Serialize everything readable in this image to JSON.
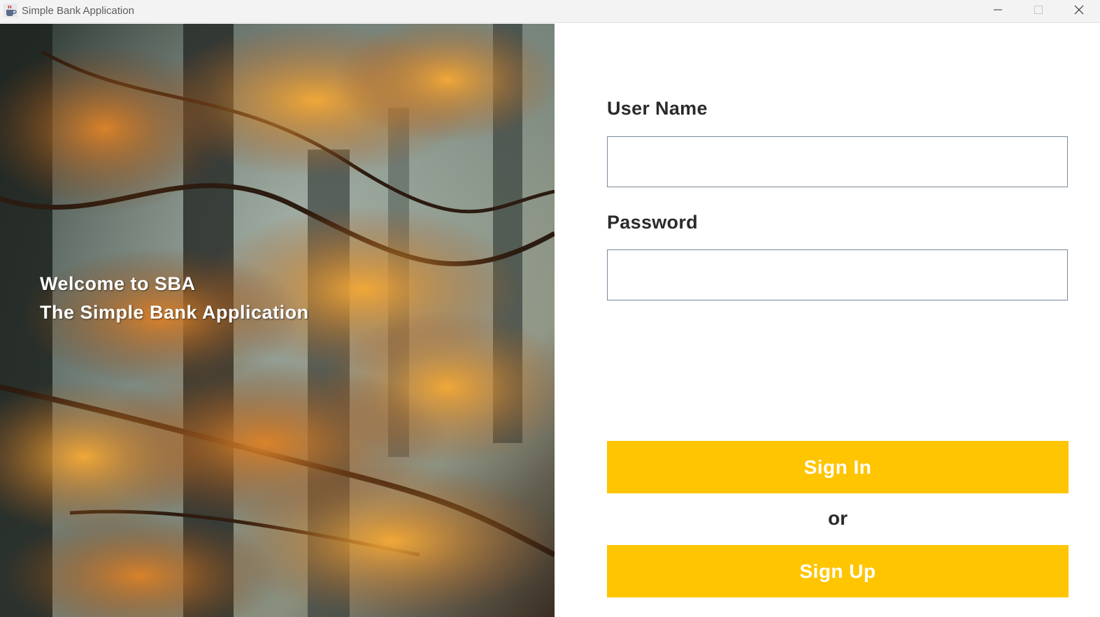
{
  "window": {
    "title": "Simple Bank Application",
    "icons": {
      "app": "java-cup-icon",
      "minimize": "minimize-icon",
      "maximize": "maximize-icon",
      "close": "close-icon"
    }
  },
  "hero": {
    "image": "autumn-forest-image",
    "welcome_line1": "Welcome to SBA",
    "welcome_line2": "The Simple Bank Application"
  },
  "form": {
    "username_label": "User Name",
    "username_value": "",
    "password_label": "Password",
    "password_value": "",
    "signin_label": "Sign In",
    "or_text": "or",
    "signup_label": "Sign Up"
  },
  "colors": {
    "accent": "#ffc500",
    "button_text": "#ffffff",
    "label_text": "#2b2b2b",
    "input_border": "#7a8a99"
  }
}
